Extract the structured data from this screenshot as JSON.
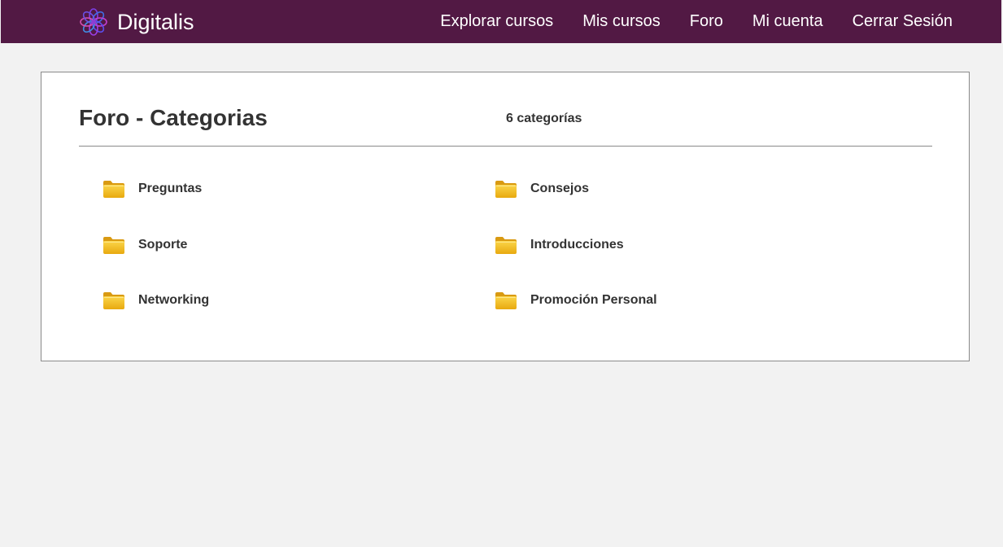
{
  "header": {
    "brand": "Digitalis",
    "background": "#521944",
    "logo_icon": "flower-logo-icon",
    "nav": [
      {
        "label": "Explorar cursos"
      },
      {
        "label": "Mis cursos"
      },
      {
        "label": "Foro"
      },
      {
        "label": "Mi cuenta"
      },
      {
        "label": "Cerrar Sesión"
      }
    ]
  },
  "panel": {
    "title": "Foro - Categorias",
    "count": "6 categorías",
    "folder_icon": "folder-icon",
    "folder_color": "#f5c518",
    "categories": [
      {
        "label": "Preguntas"
      },
      {
        "label": "Consejos"
      },
      {
        "label": "Soporte"
      },
      {
        "label": "Introducciones"
      },
      {
        "label": "Networking"
      },
      {
        "label": "Promoción Personal"
      }
    ]
  }
}
